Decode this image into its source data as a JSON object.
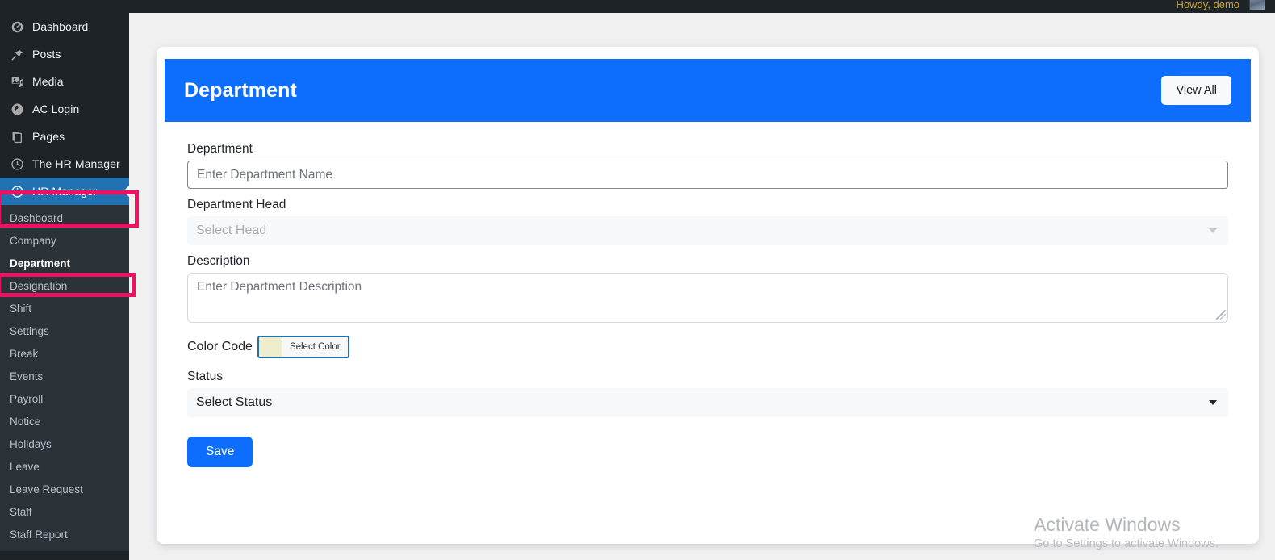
{
  "adminbar": {
    "howdy": "Howdy, demo",
    "avatar": "user-avatar"
  },
  "sidebar": {
    "menu": [
      {
        "label": "Dashboard",
        "icon": "dashboard-gauge-icon",
        "active": false
      },
      {
        "label": "Posts",
        "icon": "pin-icon",
        "active": false
      },
      {
        "label": "Media",
        "icon": "media-icon",
        "active": false
      },
      {
        "label": "AC Login",
        "icon": "ac-login-icon",
        "active": false
      },
      {
        "label": "Pages",
        "icon": "pages-book-icon",
        "active": false
      },
      {
        "label": "The HR Manager",
        "icon": "clock-icon",
        "active": false
      },
      {
        "label": "HR Manager",
        "icon": "clock-icon",
        "active": true
      }
    ],
    "submenu": [
      {
        "label": "Dashboard",
        "current": false
      },
      {
        "label": "Company",
        "current": false
      },
      {
        "label": "Department",
        "current": true
      },
      {
        "label": "Designation",
        "current": false
      },
      {
        "label": "Shift",
        "current": false
      },
      {
        "label": "Settings",
        "current": false
      },
      {
        "label": "Break",
        "current": false
      },
      {
        "label": "Events",
        "current": false
      },
      {
        "label": "Payroll",
        "current": false
      },
      {
        "label": "Notice",
        "current": false
      },
      {
        "label": "Holidays",
        "current": false
      },
      {
        "label": "Leave",
        "current": false
      },
      {
        "label": "Leave Request",
        "current": false
      },
      {
        "label": "Staff",
        "current": false
      },
      {
        "label": "Staff Report",
        "current": false
      }
    ]
  },
  "card": {
    "title": "Department",
    "view_all_label": "View All"
  },
  "form": {
    "department": {
      "label": "Department",
      "placeholder": "Enter Department Name",
      "value": ""
    },
    "department_head": {
      "label": "Department Head",
      "selected": "Select Head"
    },
    "description": {
      "label": "Description",
      "placeholder": "Enter Department Description",
      "value": ""
    },
    "color_code": {
      "label": "Color Code",
      "button_label": "Select Color",
      "swatch_color": "#eeeecc"
    },
    "status": {
      "label": "Status",
      "selected": "Select Status"
    },
    "save_label": "Save"
  },
  "watermark": {
    "title": "Activate Windows",
    "subtitle": "Go to Settings to activate Windows."
  },
  "colors": {
    "sidebar_bg": "#1d2327",
    "submenu_bg": "#2c3338",
    "active_menu": "#2271b1",
    "header_blue": "#0d6efd",
    "annotation_pink": "#ec1163"
  }
}
